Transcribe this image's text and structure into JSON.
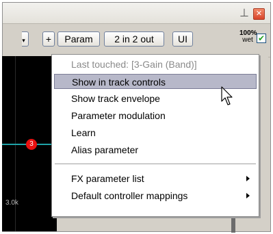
{
  "toolbar": {
    "plus_label": "+",
    "param_label": "Param",
    "io_label": "2 in 2 out",
    "ui_label": "UI",
    "wet_pct": "100%",
    "wet_label": "wet",
    "enabled_check": "✔"
  },
  "title_icons": {
    "pin": "pin-icon",
    "close": "close-icon"
  },
  "graph": {
    "node_number": "3",
    "freq_label": "3.0k"
  },
  "menu": {
    "header": "Last touched: [3-Gain (Band)]",
    "items": [
      {
        "label": "Show in track controls",
        "highlighted": true
      },
      {
        "label": "Show track envelope"
      },
      {
        "label": "Parameter modulation"
      },
      {
        "label": "Learn"
      },
      {
        "label": "Alias parameter"
      }
    ],
    "submenus": [
      {
        "label": "FX parameter list"
      },
      {
        "label": "Default controller mappings"
      }
    ]
  },
  "colors": {
    "highlight": "#b7b8c9",
    "node": "#e81010",
    "curve": "#1fa3a8"
  }
}
